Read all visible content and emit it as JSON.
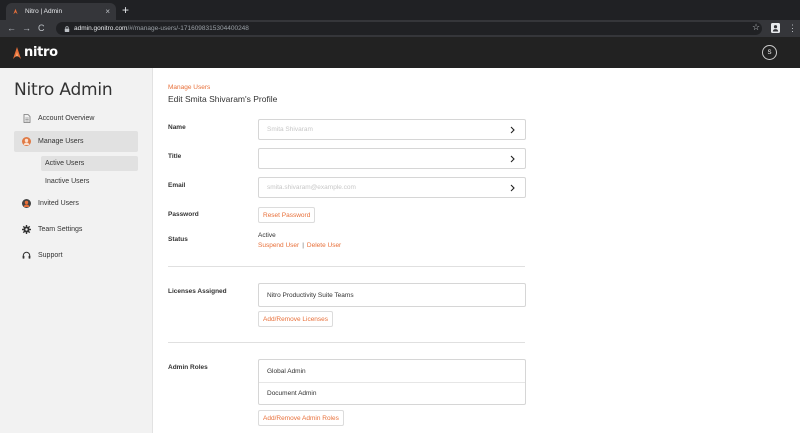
{
  "browser": {
    "tab_title": "Nitro | Admin",
    "tab_close": "×",
    "new_tab": "+",
    "back": "←",
    "forward": "→",
    "reload": "C",
    "url_host": "admin.gonitro.com",
    "url_path": "/#/manage-users/-1716098315304400248",
    "star": "☆",
    "menu": "⋮"
  },
  "header": {
    "logo_text": "nitro",
    "avatar_initial": "S",
    "brand_color": "#e8703a"
  },
  "sidebar": {
    "title": "Nitro Admin",
    "items": [
      {
        "label": "Account Overview",
        "icon": "document-icon"
      },
      {
        "label": "Manage Users",
        "icon": "user-avatar-icon",
        "active": true
      },
      {
        "label": "Invited Users",
        "icon": "invited-user-icon"
      },
      {
        "label": "Team Settings",
        "icon": "gear-icon"
      },
      {
        "label": "Support",
        "icon": "headset-icon"
      }
    ],
    "subitems": [
      {
        "label": "Active Users",
        "active": true
      },
      {
        "label": "Inactive Users"
      }
    ]
  },
  "main": {
    "breadcrumb": "Manage Users",
    "title": "Edit Smita Shivaram's Profile",
    "labels": {
      "name": "Name",
      "title": "Title",
      "email": "Email",
      "password": "Password",
      "status": "Status",
      "licenses": "Licenses Assigned",
      "roles": "Admin Roles"
    },
    "fields": {
      "name_placeholder": "Smita Shivaram",
      "title_value": "",
      "email_placeholder": "smita.shivaram@example.com"
    },
    "buttons": {
      "reset_password": "Reset Password",
      "add_remove_licenses": "Add/Remove Licenses",
      "add_remove_roles": "Add/Remove Admin Roles"
    },
    "status": {
      "value": "Active",
      "suspend": "Suspend User",
      "separator": "|",
      "delete": "Delete User"
    },
    "licenses": [
      "Nitro Productivity Suite Teams"
    ],
    "roles": [
      "Global Admin",
      "Document Admin"
    ]
  }
}
